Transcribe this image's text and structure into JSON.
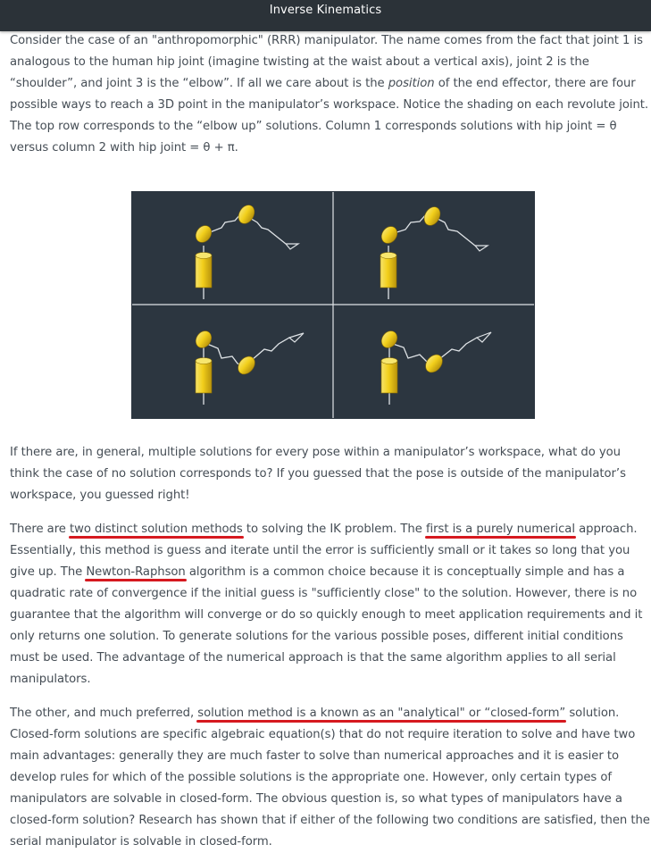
{
  "header": {
    "title": "Inverse Kinematics"
  },
  "article": {
    "p1": {
      "a": "Consider the case of an \"anthropomorphic\" (RRR) manipulator. The name comes from the fact that joint 1 is analogous to the human hip joint (imagine twisting at the waist about a vertical axis), joint 2 is the “shoulder”, and joint 3 is the “elbow”. If all we care about is the ",
      "em": "position",
      "b": " of the end effector, there are four possible ways to reach a 3D point in the manipulator’s workspace. Notice the shading on each revolute joint. The top row corresponds to the “elbow up” solutions. Column 1 corresponds solutions with hip joint = θ versus column 2 with hip joint = θ + π."
    },
    "figure": {
      "description": "Four elbow-up/elbow-down and hip θ / θ+π solutions of an RRR manipulator"
    },
    "p2": "If there are, in general, multiple solutions for every pose within a manipulator’s workspace, what do you think the case of no solution corresponds to? If you guessed that the pose is outside of the manipulator’s workspace, you guessed right!",
    "p3": {
      "a": "There are ",
      "u1": "two distinct solution methods",
      "b": " to solving the IK problem. The ",
      "u2": "first is a purely numerical",
      "c": " approach. Essentially, this method is guess and iterate until the error is sufficiently small or it takes so long that you give up. The ",
      "u3": "Newton-Raphson",
      "d": " algorithm is a common choice because it is conceptually simple and has a quadratic rate of convergence if the initial guess is \"sufficiently close\" to the solution. However, there is no guarantee that the algorithm will converge or do so quickly enough to meet application requirements and it only returns one solution. To generate solutions for the various possible poses, different initial conditions must be used. The advantage of the numerical approach is that the same algorithm applies to all serial manipulators."
    },
    "p4": {
      "a": "The other, and much preferred, ",
      "u1": "solution method is a known as an \"analytical\" or “closed-form”",
      "b": " solution. Closed-form solutions are specific algebraic equation(s) that do not require iteration to solve and have two main advantages: generally they are much faster to solve than numerical approaches and it is easier to develop rules for which of the possible solutions is the appropriate one. However, only certain types of manipulators are solvable in closed-form. The obvious question is, so what types of manipulators have a closed-form solution? Research has shown that if either of the following two conditions are satisfied, then the serial manipulator is solvable in closed-form."
    }
  },
  "colors": {
    "header_bg": "#2b3238",
    "figure_bg": "#2c3640",
    "joint_yellow": "#f2cf1b",
    "underline_red": "#d6191f"
  }
}
